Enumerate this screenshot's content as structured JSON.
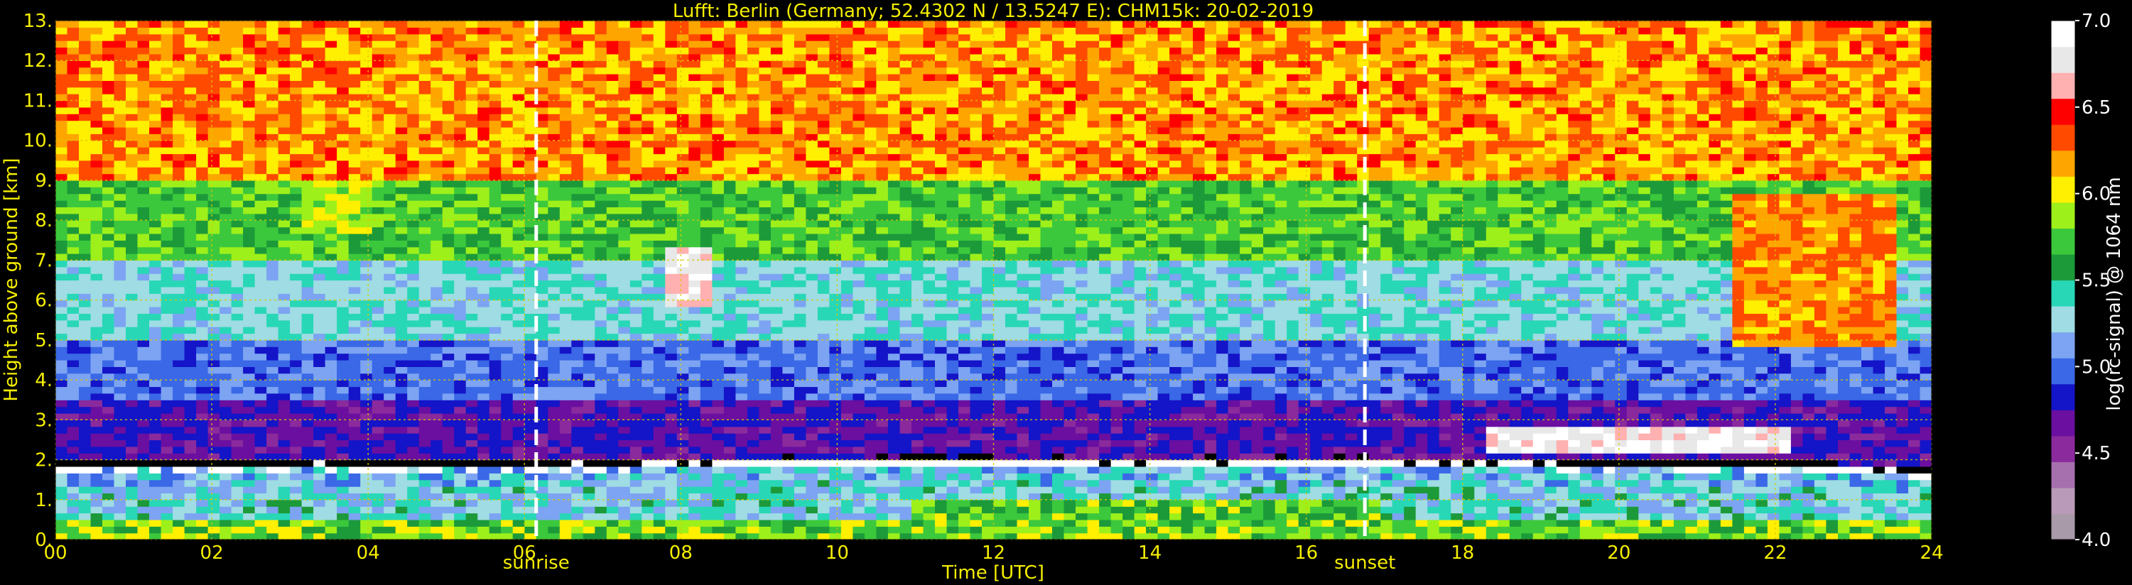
{
  "chart_data": {
    "type": "heatmap",
    "title": "Lufft: Berlin (Germany; 52.4302 N / 13.5247 E):    CHM15k: 20-02-2019",
    "xlabel": "Time [UTC]",
    "ylabel": "Height above ground [km]",
    "colorbar_label": "log(rc-signal) @ 1064 nm",
    "x_ticks": [
      "00",
      "02",
      "04",
      "06",
      "08",
      "10",
      "12",
      "14",
      "16",
      "18",
      "20",
      "22",
      "24"
    ],
    "y_ticks": [
      "0.",
      "1.",
      "2.",
      "3.",
      "4.",
      "5.",
      "6.",
      "7.",
      "8.",
      "9.",
      "10.",
      "11.",
      "12.",
      "13."
    ],
    "colorbar_ticks": [
      "4.0",
      "4.5",
      "5.0",
      "5.5",
      "6.0",
      "6.5",
      "7.0"
    ],
    "xlim": [
      0,
      24
    ],
    "ylim": [
      0,
      13
    ],
    "clim": [
      4.0,
      7.0
    ],
    "grid": true,
    "markers": [
      {
        "label": "sunrise",
        "x": 6.15
      },
      {
        "label": "sunset",
        "x": 16.75
      }
    ],
    "features": [
      {
        "kind": "boundary-layer-top",
        "points": [
          [
            0,
            1.8
          ],
          [
            4,
            1.8
          ],
          [
            6,
            1.78
          ],
          [
            8,
            1.85
          ],
          [
            10,
            1.9
          ],
          [
            12,
            1.9
          ],
          [
            14,
            1.85
          ],
          [
            16,
            1.9
          ],
          [
            18,
            1.85
          ],
          [
            20,
            1.8
          ],
          [
            22,
            1.8
          ],
          [
            24,
            1.6
          ]
        ]
      },
      {
        "kind": "cirrus",
        "x": [
          7.8,
          8.4
        ],
        "y": [
          5.8,
          7.4
        ],
        "level": 6.9
      },
      {
        "kind": "cirrus",
        "x": [
          21.5,
          23.6
        ],
        "y": [
          4.8,
          8.6
        ],
        "level": 6.4
      },
      {
        "kind": "cirrus",
        "x": [
          3.2,
          4.1
        ],
        "y": [
          7.6,
          9.3
        ],
        "level": 6.1
      },
      {
        "kind": "stratus",
        "x": [
          18.3,
          22.2
        ],
        "y": [
          2.1,
          2.9
        ],
        "level": 7.0
      }
    ],
    "colors": {
      "text": "#f5ee00",
      "grid": "#d8cc00",
      "markers": "#ffffff",
      "colormap": [
        "#a99aa9",
        "#b99bb9",
        "#a66fae",
        "#8a2a9c",
        "#6a0fa0",
        "#1414c8",
        "#3a68e6",
        "#7ca4f2",
        "#9fdce3",
        "#28d7b6",
        "#1c9a3a",
        "#3cc83c",
        "#9ef01a",
        "#ffef00",
        "#ffa500",
        "#ff4a00",
        "#ff0000",
        "#ffb0b0",
        "#e8e8e8",
        "#ffffff"
      ]
    }
  }
}
